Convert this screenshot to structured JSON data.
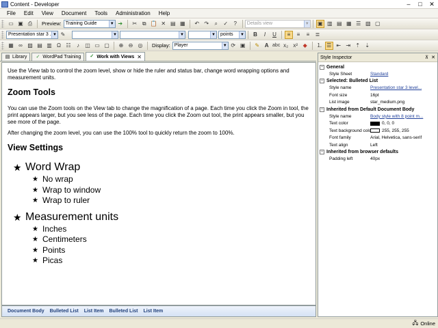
{
  "window": {
    "title": "Content - Developer"
  },
  "menu": [
    "File",
    "Edit",
    "View",
    "Document",
    "Tools",
    "Administration",
    "Help"
  ],
  "toolbar1": {
    "preview_label": "Preview:",
    "preview_value": "Training Guide",
    "view_value": "Details view"
  },
  "toolbar2": {
    "style_value": "Presentation star 3 ...",
    "size_unit": "points"
  },
  "toolbar3": {
    "display_label": "Display:",
    "display_value": "Player"
  },
  "tabs": [
    {
      "label": "Library",
      "icon": "library-icon"
    },
    {
      "label": "WordPad Training",
      "icon": "wordpad-icon"
    },
    {
      "label": "Work with Views",
      "icon": "check-icon"
    }
  ],
  "document": {
    "intro": "Use the View tab to control the zoom level, show or hide the ruler and status bar, change word wrapping options and measurement units.",
    "h_zoom": "Zoom Tools",
    "p_zoom1": "You can use the Zoom tools on the View tab to change the magnification of a page. Each time you click the Zoom in tool, the print appears larger, but you see less of the page. Each time you click the Zoom out tool, the print appears smaller, but you see more of the page.",
    "p_zoom2": "After changing the zoom level, you can use the 100% tool to quickly return the zoom to 100%.",
    "h_view": "View Settings",
    "list": [
      {
        "label": "Word Wrap",
        "items": [
          "No wrap",
          "Wrap to window",
          "Wrap to ruler"
        ]
      },
      {
        "label": "Measurement units",
        "items": [
          "Inches",
          "Centimeters",
          "Points",
          "Picas"
        ]
      }
    ]
  },
  "breadcrumbs": [
    "Document Body",
    "Bulleted List",
    "List Item",
    "Bulleted List",
    "List Item"
  ],
  "inspector": {
    "title": "Style Inspector",
    "sections": [
      {
        "title": "General",
        "props": [
          {
            "k": "Style Sheet",
            "v": "Standard",
            "link": true
          }
        ]
      },
      {
        "title": "Selected: Bulleted List",
        "props": [
          {
            "k": "Style name",
            "v": "Presentation star 3 level...",
            "link": true
          },
          {
            "k": "Font size",
            "v": "16pt"
          },
          {
            "k": "List image",
            "v": "star_medium.png"
          }
        ]
      },
      {
        "title": "Inherited from Default Document Body",
        "props": [
          {
            "k": "Style name",
            "v": "Body style with 8 point m...",
            "link": true
          },
          {
            "k": "Text color",
            "v": "0, 0, 0",
            "swatch": "#000000"
          },
          {
            "k": "Text background color",
            "v": "255, 255, 255",
            "swatch": "#ffffff"
          },
          {
            "k": "Font family",
            "v": "Arial, Helvetica, sans-serif"
          },
          {
            "k": "Text align",
            "v": "Left"
          }
        ]
      },
      {
        "title": "Inherited from browser defaults",
        "props": [
          {
            "k": "Padding left",
            "v": "40px"
          }
        ]
      }
    ]
  },
  "status": {
    "connection": "Online"
  },
  "colors": {
    "accent": "#f9d98a",
    "link": "#1f3f9a"
  }
}
